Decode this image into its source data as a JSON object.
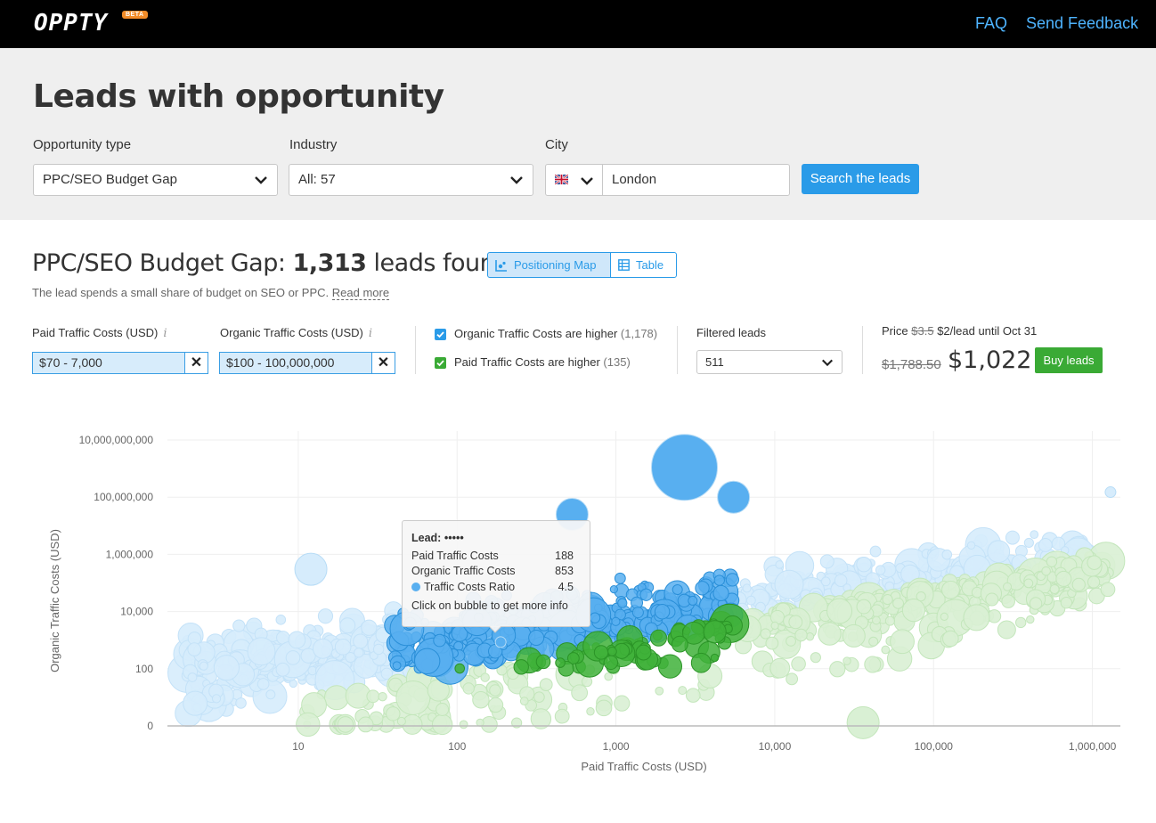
{
  "header": {
    "logo": "OPPTY",
    "beta_badge": "BETA",
    "faq": "FAQ",
    "feedback": "Send Feedback"
  },
  "hero": {
    "title": "Leads with opportunity",
    "opportunity_label": "Opportunity type",
    "opportunity_value": "PPC/SEO Budget Gap",
    "industry_label": "Industry",
    "industry_value": "All: 57",
    "city_label": "City",
    "city_value": "London",
    "search_button": "Search the leads"
  },
  "results": {
    "title_prefix": "PPC/SEO Budget Gap:",
    "count": "1,313",
    "title_suffix": "leads found",
    "view_map": "Positioning Map",
    "view_table": "Table",
    "description": "The lead spends a small share of budget on SEO or PPC.",
    "read_more": "Read more"
  },
  "filters": {
    "paid_label": "Paid Traffic Costs (USD)",
    "paid_value": "$70 - 7,000",
    "organic_label": "Organic Traffic Costs (USD)",
    "organic_value": "$100 - 100,000,000",
    "info_glyph": "i",
    "clear_glyph": "✕",
    "check1_label": "Organic Traffic Costs are higher",
    "check1_count": "(1,178)",
    "check2_label": "Paid Traffic Costs are higher",
    "check2_count": "(135)",
    "filtered_label": "Filtered leads",
    "filtered_value": "511"
  },
  "pricing": {
    "label": "Price",
    "old_per_lead": "$3.5",
    "new_per_lead": "$2/lead until Oct 31",
    "old_total": "$1,788.50",
    "new_total": "$1,022",
    "buy_button": "Buy leads"
  },
  "tooltip": {
    "lead_label": "Lead:",
    "lead_value": "•••••",
    "paid_label": "Paid Traffic Costs",
    "paid_value": "188",
    "organic_label": "Organic Traffic Costs",
    "organic_value": "853",
    "ratio_label": "Traffic Costs Ratio",
    "ratio_value": "4.5",
    "hint": "Click on bubble to get more info"
  },
  "colors": {
    "blue_selected": "#58aff0",
    "blue_faded": "#d6ecfc",
    "green_selected": "#3fb23a",
    "green_faded": "#d9f0d4",
    "accent": "#2a9be8",
    "buy": "#3aaa35"
  },
  "chart_data": {
    "type": "scatter",
    "xlabel": "Paid Traffic Costs (USD)",
    "ylabel": "Organic Traffic Costs (USD)",
    "x_scale": "log",
    "y_scale": "log",
    "xlim": [
      1.5,
      1500000
    ],
    "ylim": [
      1,
      10000000000
    ],
    "x_ticks": [
      {
        "value": 10,
        "label": "10"
      },
      {
        "value": 100,
        "label": "100"
      },
      {
        "value": 1000,
        "label": "1,000"
      },
      {
        "value": 10000,
        "label": "10,000"
      },
      {
        "value": 100000,
        "label": "100,000"
      },
      {
        "value": 1000000,
        "label": "1,000,000"
      }
    ],
    "y_ticks": [
      {
        "value": 1,
        "label": "0"
      },
      {
        "value": 100,
        "label": "100"
      },
      {
        "value": 10000,
        "label": "10,000"
      },
      {
        "value": 1000000,
        "label": "1,000,000"
      },
      {
        "value": 100000000,
        "label": "100,000,000"
      },
      {
        "value": 10000000000,
        "label": "10,000,000,000"
      }
    ],
    "grid": true,
    "selected_range": {
      "x": [
        40,
        5500
      ],
      "y_min": 100
    },
    "series": [
      {
        "name": "Organic Traffic Costs are higher",
        "color": "#58aff0"
      },
      {
        "name": "Paid Traffic Costs are higher",
        "color": "#3fb23a"
      }
    ],
    "highlight_points": [
      {
        "x": 2700,
        "y": 1100000000,
        "size": 3
      },
      {
        "x": 5500,
        "y": 100000000,
        "size": 2
      },
      {
        "x": 530,
        "y": 25000000,
        "size": 2
      },
      {
        "x": 12,
        "y": 300000,
        "size": 2
      },
      {
        "x": 36000,
        "y": 1.3,
        "size": 2
      },
      {
        "x": 188,
        "y": 853,
        "size": 1
      },
      {
        "x": 1300000,
        "y": 150000000,
        "size": 1
      }
    ]
  }
}
